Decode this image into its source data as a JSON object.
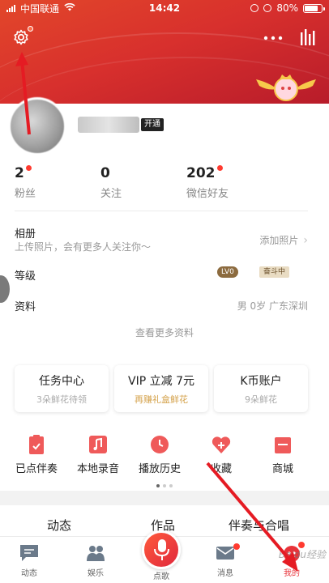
{
  "status_bar": {
    "carrier": "中国联通",
    "time": "14:42",
    "battery": "80%"
  },
  "profile": {
    "vip_tag": "开通"
  },
  "stats": [
    {
      "value": "2",
      "label": "粉丝",
      "dot": true
    },
    {
      "value": "0",
      "label": "关注",
      "dot": false
    },
    {
      "value": "202",
      "label": "微信好友",
      "dot": true
    }
  ],
  "album": {
    "title": "相册",
    "subtitle": "上传照片，会有更多人关注你～",
    "action": "添加照片"
  },
  "level": {
    "title": "等级",
    "badge1": "LV0",
    "badge2": "奋斗中"
  },
  "info": {
    "title": "资料",
    "value": "男 0岁 广东深圳"
  },
  "see_more": "查看更多资料",
  "cards": [
    {
      "title": "任务中心",
      "sub": "3朵鲜花待领"
    },
    {
      "title": "VIP 立减 7元",
      "sub": "再赚礼盒鲜花"
    },
    {
      "title": "K币账户",
      "sub": "9朵鲜花"
    }
  ],
  "shortcuts": [
    {
      "label": "已点伴奏",
      "icon": "clipboard-icon"
    },
    {
      "label": "本地录音",
      "icon": "music-note-icon"
    },
    {
      "label": "播放历史",
      "icon": "clock-icon"
    },
    {
      "label": "收藏",
      "icon": "heart-plus-icon"
    },
    {
      "label": "商城",
      "icon": "shop-icon"
    }
  ],
  "tabs": [
    "动态",
    "作品",
    "伴奏与合唱"
  ],
  "bottom_nav": [
    {
      "label": "动态",
      "icon": "message-square-icon"
    },
    {
      "label": "娱乐",
      "icon": "people-icon"
    },
    {
      "label": "点歌",
      "icon": "microphone-icon"
    },
    {
      "label": "消息",
      "icon": "mail-icon"
    },
    {
      "label": "我的",
      "icon": "profile-face-icon"
    }
  ],
  "watermark": "Baidu经验",
  "colors": {
    "brand": "#e8333a",
    "header_start": "#e2472a",
    "header_end": "#b51a2a",
    "gold": "#d4a24b"
  }
}
